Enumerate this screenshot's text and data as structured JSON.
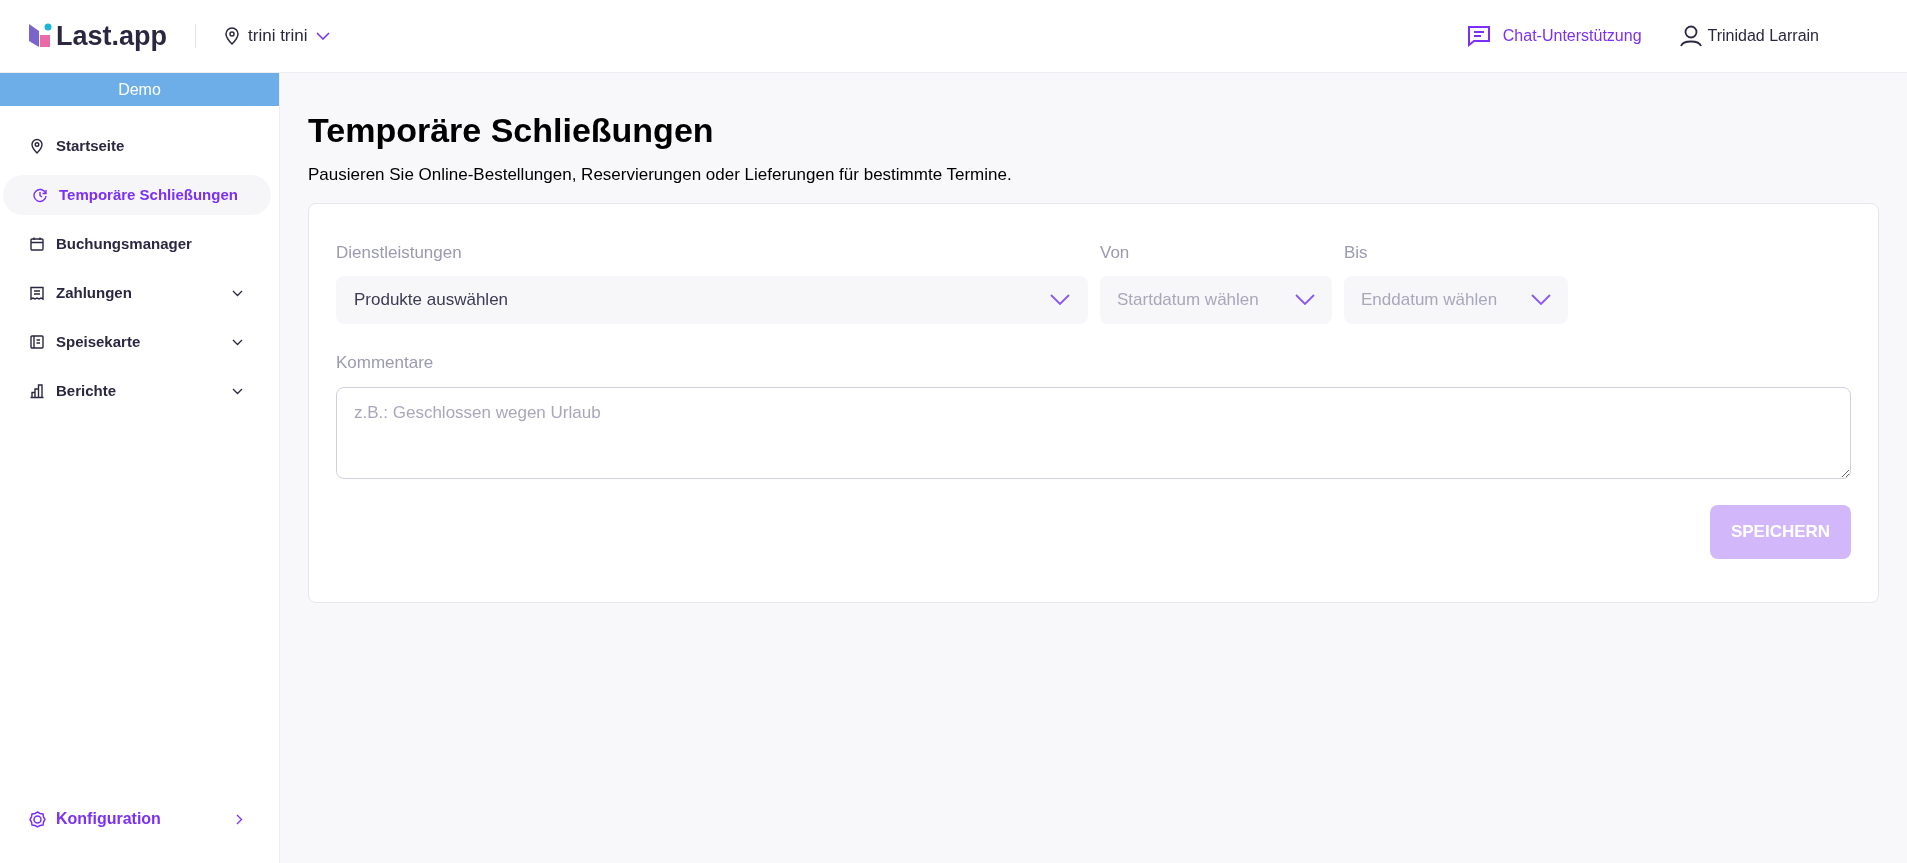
{
  "header": {
    "logo": "Last.app",
    "location": "trini trini",
    "support": "Chat-Unterstützung",
    "user": "Trinidad Larrain"
  },
  "sidebar": {
    "banner": "Demo",
    "items": [
      {
        "label": "Startseite",
        "kind": "pin",
        "selected": false,
        "expandable": false
      },
      {
        "label": "Temporäre Schließungen",
        "kind": "clock",
        "selected": true,
        "expandable": false
      },
      {
        "label": "Buchungsmanager",
        "kind": "calendar",
        "selected": false,
        "expandable": false
      },
      {
        "label": "Zahlungen",
        "kind": "receipt",
        "selected": false,
        "expandable": true
      },
      {
        "label": "Speisekarte",
        "kind": "menu",
        "selected": false,
        "expandable": true
      },
      {
        "label": "Berichte",
        "kind": "chart",
        "selected": false,
        "expandable": true
      }
    ],
    "footer": {
      "label": "Konfiguration"
    }
  },
  "page": {
    "title": "Temporäre Schließungen",
    "subtitle": "Pausieren Sie Online-Bestellungen, Reservierungen oder Lieferungen für bestimmte Termine."
  },
  "form": {
    "services": {
      "label": "Dienstleistungen",
      "value": "Produkte auswählen"
    },
    "from": {
      "label": "Von",
      "placeholder": "Startdatum wählen"
    },
    "to": {
      "label": "Bis",
      "placeholder": "Enddatum wählen"
    },
    "comments": {
      "label": "Kommentare",
      "placeholder": "z.B.: Geschlossen wegen Urlaub"
    },
    "save": {
      "label": "SPEICHERN",
      "disabled": true
    }
  }
}
